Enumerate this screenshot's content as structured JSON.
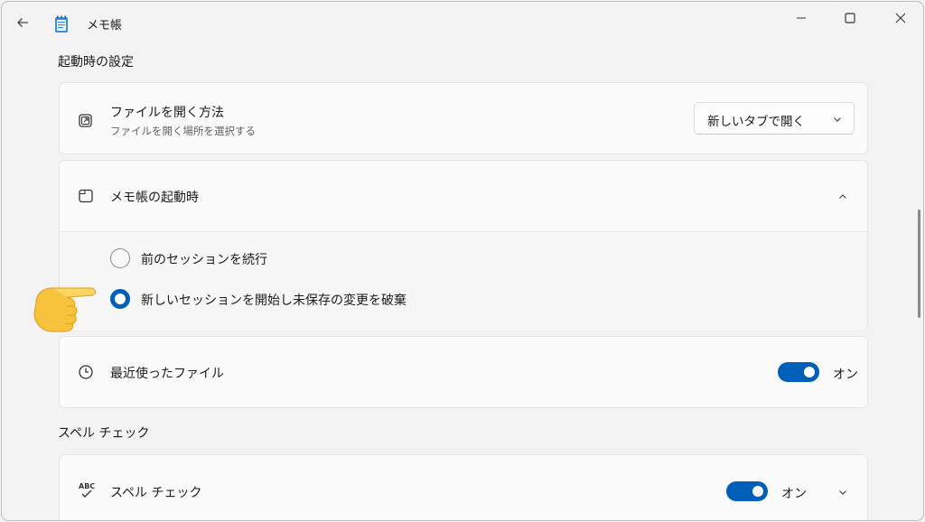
{
  "app": {
    "title": "メモ帳"
  },
  "colors": {
    "accent": "#005fb8",
    "background": "#f3f3f3",
    "card": "#fbfbfb"
  },
  "sections": {
    "startup": "起動時の設定",
    "spell": "スペル チェック"
  },
  "open_file": {
    "title": "ファイルを開く方法",
    "subtitle": "ファイルを開く場所を選択する",
    "dropdown_value": "新しいタブで開く"
  },
  "on_startup": {
    "title": "メモ帳の起動時",
    "options": [
      {
        "label": "前のセッションを続行",
        "checked": false
      },
      {
        "label": "新しいセッションを開始し未保存の変更を破棄",
        "checked": true
      }
    ]
  },
  "recent_files": {
    "title": "最近使ったファイル",
    "state": "オン"
  },
  "spell_check": {
    "title": "スペル チェック",
    "state": "オン"
  },
  "icons": {
    "back": "arrow-left-icon",
    "app": "notepad-icon",
    "minimize": "minimize-icon",
    "maximize": "maximize-icon",
    "close": "close-icon",
    "open_file": "open-external-icon",
    "startup": "window-icon",
    "recent": "clock-icon",
    "spell": "spellcheck-icon",
    "pointer": "pointing-hand-icon"
  }
}
